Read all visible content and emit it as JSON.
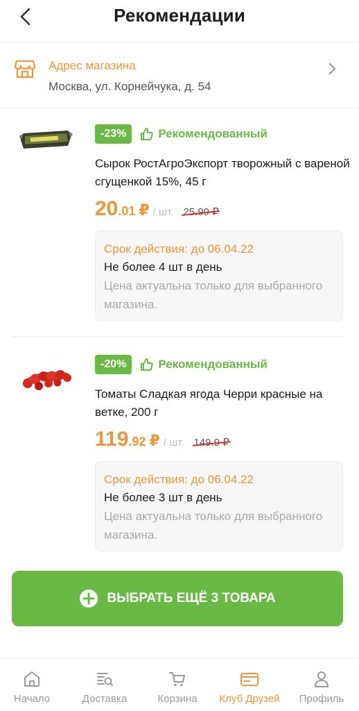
{
  "header": {
    "title": "Рекомендации"
  },
  "store": {
    "title": "Адрес магазина",
    "address": "Москва, ул. Корнейчука, д. 54"
  },
  "products": [
    {
      "discount": "-23%",
      "recommended_label": "Рекомендованный",
      "name": "Сырок РостАгроЭкспорт творожный с вареной сгущенкой 15%, 45 г",
      "price_int": "20",
      "price_dec": ".01",
      "currency": "₽",
      "unit": "/ шт.",
      "old_price": "25.99 ₽",
      "validity": "Срок действия: до 06.04.22",
      "limit": "Не более 4 шт в день",
      "note": "Цена актуальна только для выбранного магазина."
    },
    {
      "discount": "-20%",
      "recommended_label": "Рекомендованный",
      "name": "Томаты Сладкая ягода Черри красные на ветке, 200 г",
      "price_int": "119",
      "price_dec": ".92",
      "currency": "₽",
      "unit": "/ шт.",
      "old_price": "149.9 ₽",
      "validity": "Срок действия: до 06.04.22",
      "limit": "Не более 3 шт в день",
      "note": "Цена актуальна только для выбранного магазина."
    }
  ],
  "cta": {
    "label": "ВЫБРАТЬ ЕЩЁ 3 ТОВАРА"
  },
  "nav": {
    "items": [
      {
        "label": "Начало",
        "icon": "home-icon"
      },
      {
        "label": "Доставка",
        "icon": "delivery-icon"
      },
      {
        "label": "Корзина",
        "icon": "cart-icon"
      },
      {
        "label": "Клуб Друзей",
        "icon": "club-card-icon"
      },
      {
        "label": "Профиль",
        "icon": "profile-icon"
      }
    ],
    "active_index": 3
  },
  "colors": {
    "accent_orange": "#f0953a",
    "accent_green": "#6ab944",
    "strike_red": "#d9302c"
  }
}
